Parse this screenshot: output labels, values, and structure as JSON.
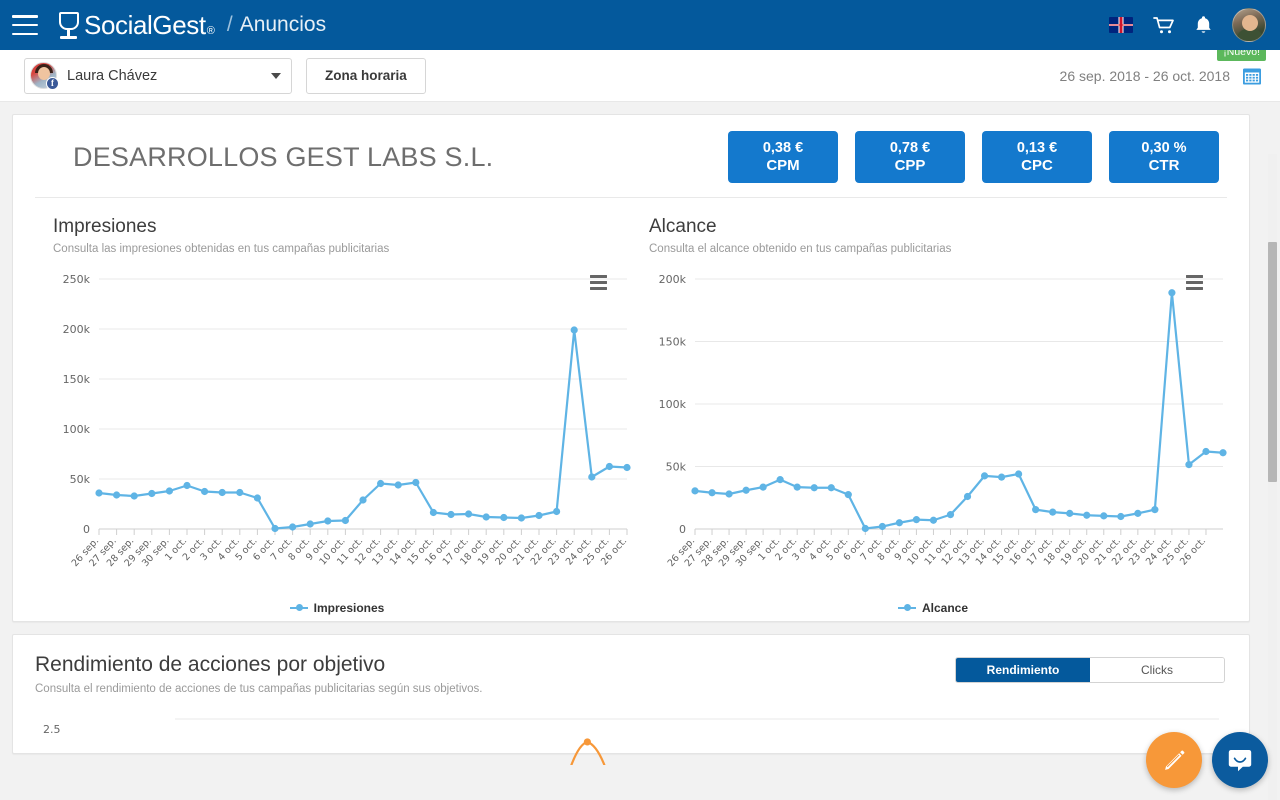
{
  "navbar": {
    "brand": "SocialGest",
    "brand_reg": "®",
    "separator": "/",
    "page": "Anuncios",
    "menu_icon": "hamburger-icon",
    "language_icon": "uk-flag-icon",
    "cart_icon": "shopping-cart-icon",
    "bell_icon": "notification-bell-icon",
    "avatar": "user-avatar"
  },
  "subheader": {
    "account_name": "Laura Chávez",
    "account_network": "f",
    "timezone_button": "Zona horaria",
    "date_range": "26 sep. 2018 - 26 oct. 2018",
    "new_badge": "¡Nuevo!",
    "calendar_icon": "calendar-icon"
  },
  "company": {
    "title": "DESARROLLOS GEST LABS S.L."
  },
  "kpis": [
    {
      "value": "0,38 €",
      "label": "CPM"
    },
    {
      "value": "0,78 €",
      "label": "CPP"
    },
    {
      "value": "0,13 €",
      "label": "CPC"
    },
    {
      "value": "0,30 %",
      "label": "CTR"
    }
  ],
  "impresiones": {
    "title": "Impresiones",
    "subtitle": "Consulta las impresiones obtenidas en tus campañas publicitarias",
    "legend": "Impresiones",
    "menu_icon": "chart-context-menu-icon"
  },
  "alcance": {
    "title": "Alcance",
    "subtitle": "Consulta el alcance obtenido en tus campañas publicitarias",
    "legend": "Alcance",
    "menu_icon": "chart-context-menu-icon"
  },
  "rendimiento": {
    "title": "Rendimiento de acciones por objetivo",
    "subtitle": "Consulta el rendimiento de acciones de tus campañas publicitarias según sus objetivos.",
    "tabs": [
      {
        "label": "Rendimiento",
        "active": true
      },
      {
        "label": "Clicks",
        "active": false
      }
    ],
    "y_label": "2.5"
  },
  "fab": {
    "edit_icon": "pencil-icon",
    "chat_icon": "intercom-chat-icon"
  },
  "colors": {
    "navbar": "#04599c",
    "kpi": "#1479cd",
    "series": "#5fb4e5",
    "accent_orange": "#f79839",
    "badge_green": "#5cb85c"
  },
  "chart_data": [
    {
      "type": "line",
      "title": "Impresiones",
      "xlabel": "",
      "ylabel": "",
      "ylim": [
        0,
        250000
      ],
      "yticks": [
        0,
        50000,
        100000,
        150000,
        200000,
        250000
      ],
      "ytick_labels": [
        "0",
        "50k",
        "100k",
        "150k",
        "200k",
        "250k"
      ],
      "grid": true,
      "legend": "Impresiones",
      "legend_position": "bottom",
      "categories": [
        "26 sep.",
        "27 sep.",
        "28 sep.",
        "29 sep.",
        "30 sep.",
        "1 oct.",
        "2 oct.",
        "3 oct.",
        "4 oct.",
        "5 oct.",
        "6 oct.",
        "7 oct.",
        "8 oct.",
        "9 oct.",
        "10 oct.",
        "11 oct.",
        "12 oct.",
        "13 oct.",
        "14 oct.",
        "15 oct.",
        "16 oct.",
        "17 oct.",
        "18 oct.",
        "19 oct.",
        "20 oct.",
        "21 oct.",
        "22 oct.",
        "23 oct.",
        "24 oct.",
        "25 oct.",
        "26 oct."
      ],
      "values": [
        36000,
        34000,
        33000,
        35500,
        38000,
        43500,
        37500,
        36500,
        36500,
        31000,
        500,
        2000,
        5000,
        8000,
        8500,
        29000,
        45500,
        44000,
        46500,
        16500,
        14500,
        15000,
        12000,
        11500,
        11000,
        13500,
        17500,
        199000,
        52000,
        62500,
        61500
      ]
    },
    {
      "type": "line",
      "title": "Alcance",
      "xlabel": "",
      "ylabel": "",
      "ylim": [
        0,
        200000
      ],
      "yticks": [
        0,
        50000,
        100000,
        150000,
        200000
      ],
      "ytick_labels": [
        "0",
        "50k",
        "100k",
        "150k",
        "200k"
      ],
      "grid": true,
      "legend": "Alcance",
      "legend_position": "bottom",
      "categories": [
        "26 sep.",
        "27 sep.",
        "28 sep.",
        "29 sep.",
        "30 sep.",
        "1 oct.",
        "2 oct.",
        "3 oct.",
        "4 oct.",
        "5 oct.",
        "6 oct.",
        "7 oct.",
        "8 oct.",
        "9 oct.",
        "10 oct.",
        "11 oct.",
        "12 oct.",
        "13 oct.",
        "14 oct.",
        "15 oct.",
        "16 oct.",
        "17 oct.",
        "18 oct.",
        "19 oct.",
        "20 oct.",
        "21 oct.",
        "22 oct.",
        "23 oct.",
        "24 oct.",
        "25 oct.",
        "26 oct."
      ],
      "values": [
        30500,
        29000,
        28000,
        31000,
        33500,
        39500,
        33500,
        33000,
        33000,
        27500,
        400,
        2000,
        5000,
        7500,
        7000,
        11500,
        26000,
        42500,
        41500,
        44000,
        15500,
        13500,
        12500,
        11000,
        10500,
        10000,
        12500,
        15500,
        189000,
        51500,
        62000,
        61000
      ]
    },
    {
      "type": "line",
      "title": "Rendimiento de acciones por objetivo",
      "ylim": [
        0,
        2.5
      ],
      "yticks": [
        2.5
      ],
      "ytick_labels": [
        "2.5"
      ],
      "grid": true,
      "series": [
        {
          "name": "Rendimiento",
          "color": "#f79839",
          "peak_x": 0.395,
          "peak_y": 2.1
        }
      ],
      "note": "Only the top portion of this chart is visible in the viewport; a single orange peak appears near the horizontal center."
    }
  ]
}
